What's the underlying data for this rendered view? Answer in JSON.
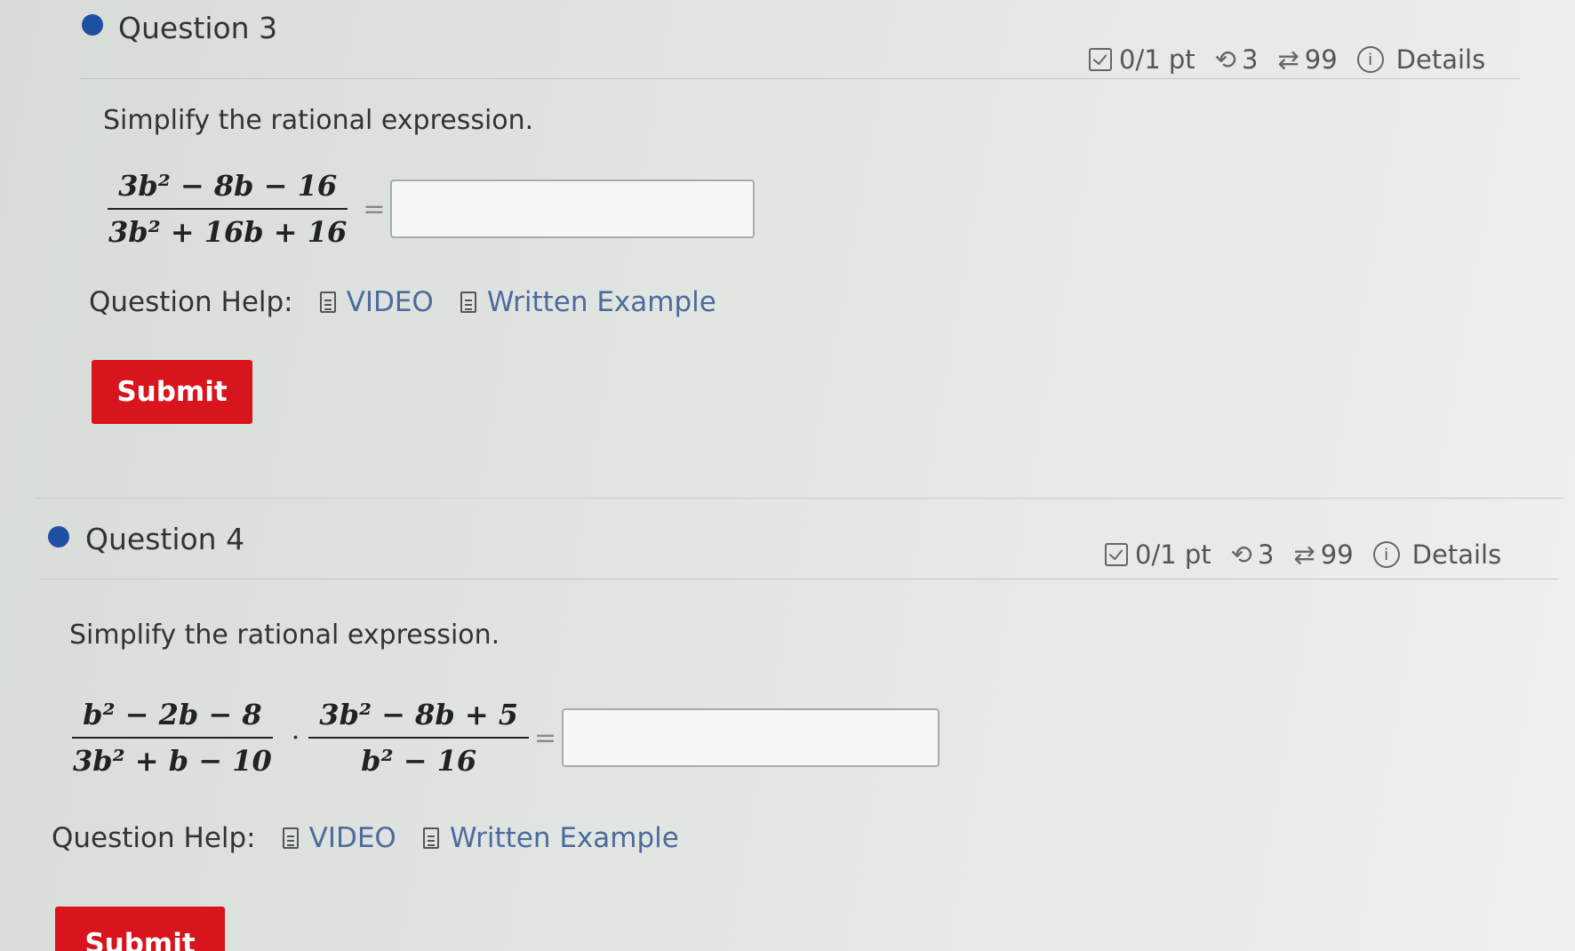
{
  "questions": [
    {
      "title": "Question 3",
      "score": "0/1 pt",
      "attempts": "3",
      "tries": "99",
      "details_label": "Details",
      "prompt": "Simplify the rational expression.",
      "expr": {
        "num": "3b² − 8b − 16",
        "den": "3b² + 16b + 16"
      },
      "equals": "=",
      "help_label": "Question Help:",
      "video_label": "VIDEO",
      "example_label": "Written Example",
      "submit_label": "Submit"
    },
    {
      "title": "Question 4",
      "score": "0/1 pt",
      "attempts": "3",
      "tries": "99",
      "details_label": "Details",
      "prompt": "Simplify the rational expression.",
      "expr1": {
        "num": "b² − 2b − 8",
        "den": "3b² + b − 10"
      },
      "times": "·",
      "expr2": {
        "num": "3b² − 8b + 5",
        "den": "b² − 16"
      },
      "equals": "=",
      "help_label": "Question Help:",
      "video_label": "VIDEO",
      "example_label": "Written Example",
      "submit_label": "Submit"
    }
  ],
  "colors": {
    "accent_dot": "#1f4fa3",
    "submit_bg": "#d8141c",
    "link": "#4d6b9e"
  },
  "icons": [
    "check-square-icon",
    "retry-icon",
    "repeat-icon",
    "info-icon",
    "document-icon"
  ]
}
